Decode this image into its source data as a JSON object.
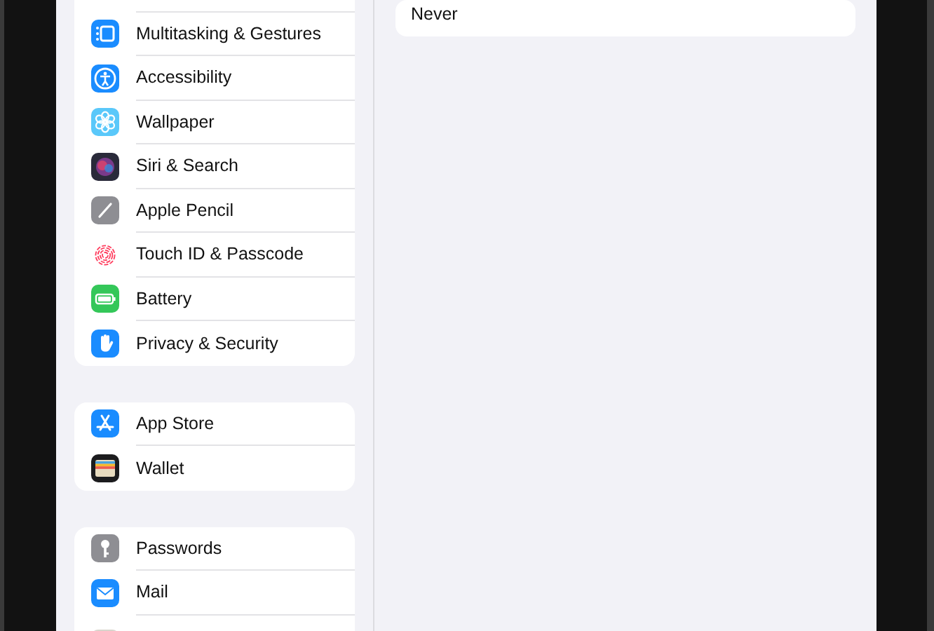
{
  "sidebar": {
    "groups": [
      {
        "items": [
          {
            "label": "Multitasking & Gestures"
          },
          {
            "label": "Accessibility"
          },
          {
            "label": "Wallpaper"
          },
          {
            "label": "Siri & Search"
          },
          {
            "label": "Apple Pencil"
          },
          {
            "label": "Touch ID & Passcode"
          },
          {
            "label": "Battery"
          },
          {
            "label": "Privacy & Security"
          }
        ]
      },
      {
        "items": [
          {
            "label": "App Store"
          },
          {
            "label": "Wallet"
          }
        ]
      },
      {
        "items": [
          {
            "label": "Passwords"
          },
          {
            "label": "Mail"
          }
        ]
      }
    ]
  },
  "detail": {
    "option": "Never"
  }
}
